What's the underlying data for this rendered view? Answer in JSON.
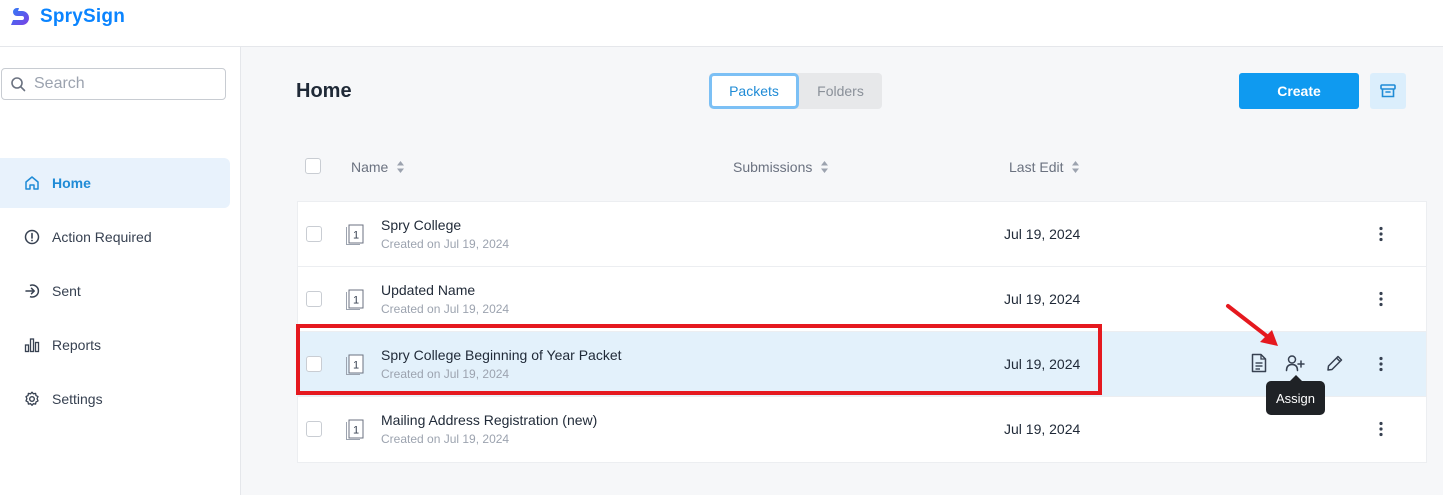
{
  "app": {
    "name": "SprySign"
  },
  "search": {
    "placeholder": "Search"
  },
  "sidebar": {
    "items": [
      {
        "label": "Home",
        "icon": "home-icon",
        "active": true
      },
      {
        "label": "Action Required",
        "icon": "alert-circle-icon"
      },
      {
        "label": "Sent",
        "icon": "sent-icon"
      },
      {
        "label": "Reports",
        "icon": "bar-chart-icon"
      },
      {
        "label": "Settings",
        "icon": "gear-icon"
      }
    ]
  },
  "main": {
    "title": "Home",
    "tabs": [
      {
        "label": "Packets",
        "selected": true
      },
      {
        "label": "Folders"
      }
    ],
    "create_label": "Create",
    "columns": {
      "name": "Name",
      "submissions": "Submissions",
      "last_edit": "Last Edit"
    }
  },
  "rows": [
    {
      "name": "Spry College",
      "created": "Created on Jul 19, 2024",
      "last_edit": "Jul 19, 2024",
      "doc_count": "1"
    },
    {
      "name": "Updated Name",
      "created": "Created on Jul 19, 2024",
      "last_edit": "Jul 19, 2024",
      "doc_count": "1"
    },
    {
      "name": "Spry College Beginning of Year Packet",
      "created": "Created on Jul 19, 2024",
      "last_edit": "Jul 19, 2024",
      "doc_count": "1",
      "highlighted": true
    },
    {
      "name": "Mailing Address Registration (new)",
      "created": "Created on Jul 19, 2024",
      "last_edit": "Jul 19, 2024",
      "doc_count": "1"
    }
  ],
  "tooltip": {
    "label": "Assign"
  },
  "colors": {
    "brand": "#0a84ff",
    "primary": "#0f9af0",
    "active_bg": "#e8f2fc",
    "annotation": "#e5191f"
  }
}
